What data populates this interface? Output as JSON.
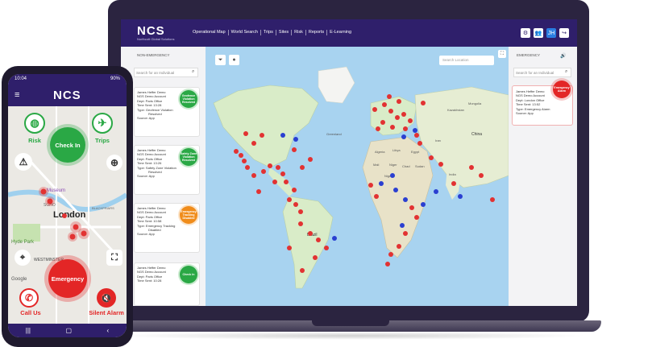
{
  "desktop": {
    "logo": "NCS",
    "logo_sub": "Northcott Global Solutions",
    "nav": [
      "Operational Map",
      "World Search",
      "Trips",
      "Sites",
      "Risk",
      "Reports",
      "E-Learning"
    ],
    "left_panel": {
      "title": "NON-EMERGENCY",
      "search_placeholder": "Search for an Individual",
      "cards": [
        {
          "lines": [
            "James Heffer Demo",
            "NGS Demo Account",
            "Dept: Paris Office",
            "Time Sent: 13:28",
            "Type: Geofence Violation",
            "Resolved",
            "Source: App"
          ],
          "badge": "Geofence Violation Resolved",
          "color": "#2aa845"
        },
        {
          "lines": [
            "James Heffer Demo",
            "NGS Demo Account",
            "Dept: Paris Office",
            "Time Sent: 13:26",
            "Type: Safety Zone Violation",
            "Resolved",
            "Source: App"
          ],
          "badge": "Safety Zone Violation Resolved",
          "color": "#2aa845"
        },
        {
          "lines": [
            "James Heffer Demo",
            "NGS Demo Account",
            "Dept: Paris Office",
            "Time Sent: 10:58",
            "Type: Emergency Tracking",
            "Disabled",
            "Source: App"
          ],
          "badge": "Emergency Tracking Disabled",
          "color": "#f08c1a"
        },
        {
          "lines": [
            "James Heffer Demo",
            "NGS Demo Account",
            "Dept: Paris Office",
            "Time Sent: 10:28"
          ],
          "badge": "Check In",
          "color": "#2aa845"
        }
      ]
    },
    "map": {
      "search_placeholder": "Search Location",
      "labels": [
        "Greenland",
        "Brazil",
        "Algeria",
        "Libya",
        "Egypt",
        "Mali",
        "Niger",
        "Chad",
        "Sudan",
        "Nigeria",
        "Kazakhstan",
        "China",
        "India",
        "Iran",
        "Mongolia"
      ]
    },
    "right_panel": {
      "title": "EMERGENCY",
      "search_placeholder": "Search for an Individual",
      "card_lines": [
        "James Heffer Demo",
        "NGS Demo Account",
        "Dept: London Office",
        "Time Sent: 13:52",
        "Type: Emergency Alarm",
        "Source: App"
      ],
      "badge": "Emergency Alarm"
    }
  },
  "phone": {
    "time": "10:04",
    "battery": "90%",
    "logo": "NCS",
    "map_labels": [
      "London",
      "Museum",
      "SOHO",
      "Hyde Park",
      "WESTMINSTER",
      "BLACKFRIARS",
      "Google"
    ],
    "risk_label": "Risk",
    "trips_label": "Trips",
    "checkin_label": "Check In",
    "emergency_label": "Emergency",
    "callus_label": "Call Us",
    "silent_label": "Silent Alarm",
    "nav": [
      "|||",
      "▢",
      "‹"
    ]
  }
}
